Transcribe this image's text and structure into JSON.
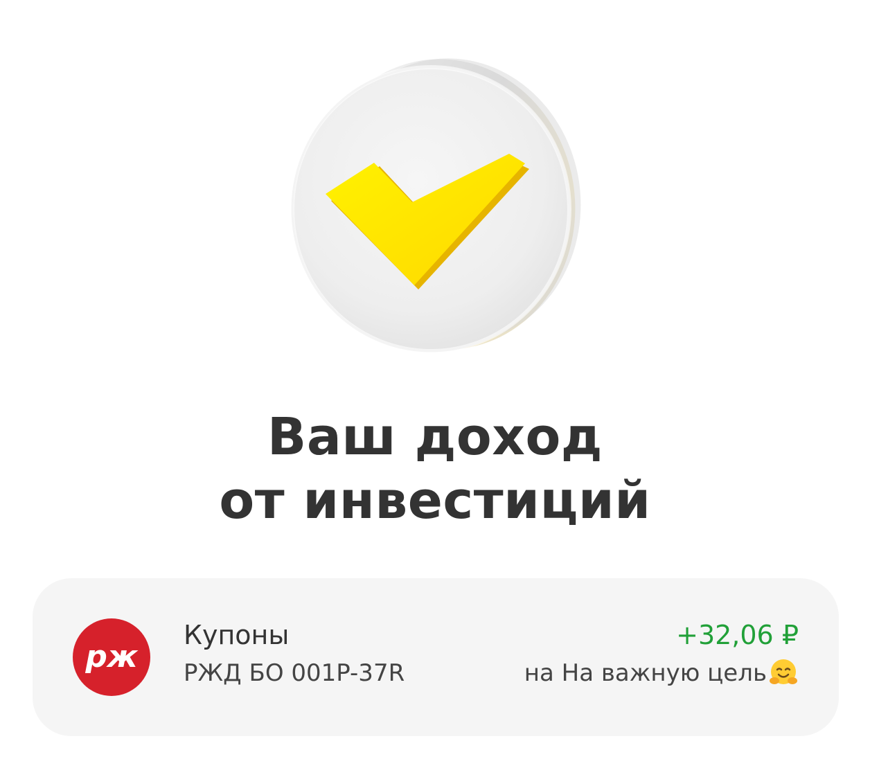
{
  "hero": {
    "icon": "yellow-check-mark-badge-icon",
    "check_color": "#ffe016"
  },
  "title": {
    "line1": "Ваш доход",
    "line2": "от инвестиций"
  },
  "operation": {
    "logo": "rzd-logo-icon",
    "logo_color": "#d6212b",
    "title": "Купоны",
    "subtitle": "РЖД БО 001P-37R",
    "amount": "+32,06 ₽",
    "amount_color": "#21a038",
    "target": "на На важную цель",
    "target_emoji": "hugging-face-emoji"
  }
}
